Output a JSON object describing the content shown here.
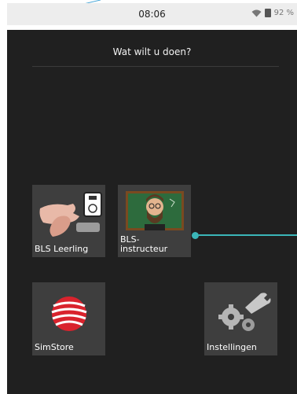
{
  "status_bar": {
    "time": "08:06",
    "battery": "92 %"
  },
  "header": {
    "title": "Wat wilt u doen?"
  },
  "tiles": [
    {
      "label": "BLS Leerling"
    },
    {
      "label": "BLS-",
      "label2": "instructeur"
    },
    {
      "label": "SimStore"
    },
    {
      "label": "Instellingen"
    }
  ],
  "colors": {
    "background": "#202020",
    "tile": "#3e3e3e",
    "accent": "#3bb6b8",
    "brand_red": "#d9232d"
  }
}
